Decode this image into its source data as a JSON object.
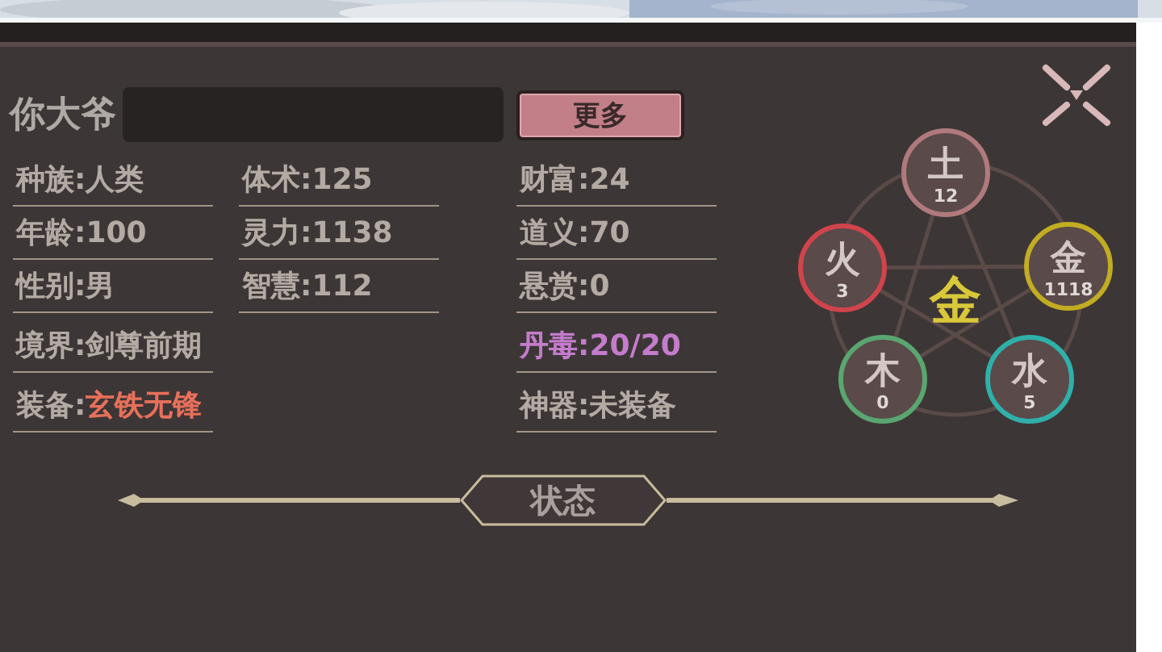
{
  "header": {
    "name": "你大爷",
    "more_button": "更多"
  },
  "stat_columns": [
    [
      {
        "label": "种族:",
        "value": "人类"
      },
      {
        "label": "年龄:",
        "value": "100"
      },
      {
        "label": "性别:",
        "value": "男"
      },
      {
        "label": "境界:",
        "value": "剑尊前期"
      },
      {
        "label": "装备:",
        "value": "玄铁无锋",
        "color": "#e8705a",
        "kind": "accent"
      }
    ],
    [
      {
        "label": "体术:",
        "value": "125"
      },
      {
        "label": "灵力:",
        "value": "1138"
      },
      {
        "label": "智慧:",
        "value": "112"
      }
    ],
    [
      {
        "label": "财富:",
        "value": "24"
      },
      {
        "label": "道义:",
        "value": "70"
      },
      {
        "label": "悬赏:",
        "value": "0"
      },
      {
        "label": "丹毒:",
        "value": "20/20",
        "color": "#c47ccc",
        "kind": "alert"
      },
      {
        "label": "神器:",
        "value": "未装备"
      }
    ]
  ],
  "elements": {
    "center": "金",
    "nodes": [
      {
        "name": "土",
        "value": "12",
        "color": "#b07a7c"
      },
      {
        "name": "火",
        "value": "3",
        "color": "#d0444c"
      },
      {
        "name": "金",
        "value": "1118",
        "color": "#c2ad22"
      },
      {
        "name": "木",
        "value": "0",
        "color": "#5aa670"
      },
      {
        "name": "水",
        "value": "5",
        "color": "#2fb0aa"
      }
    ]
  },
  "section_title": "状态"
}
